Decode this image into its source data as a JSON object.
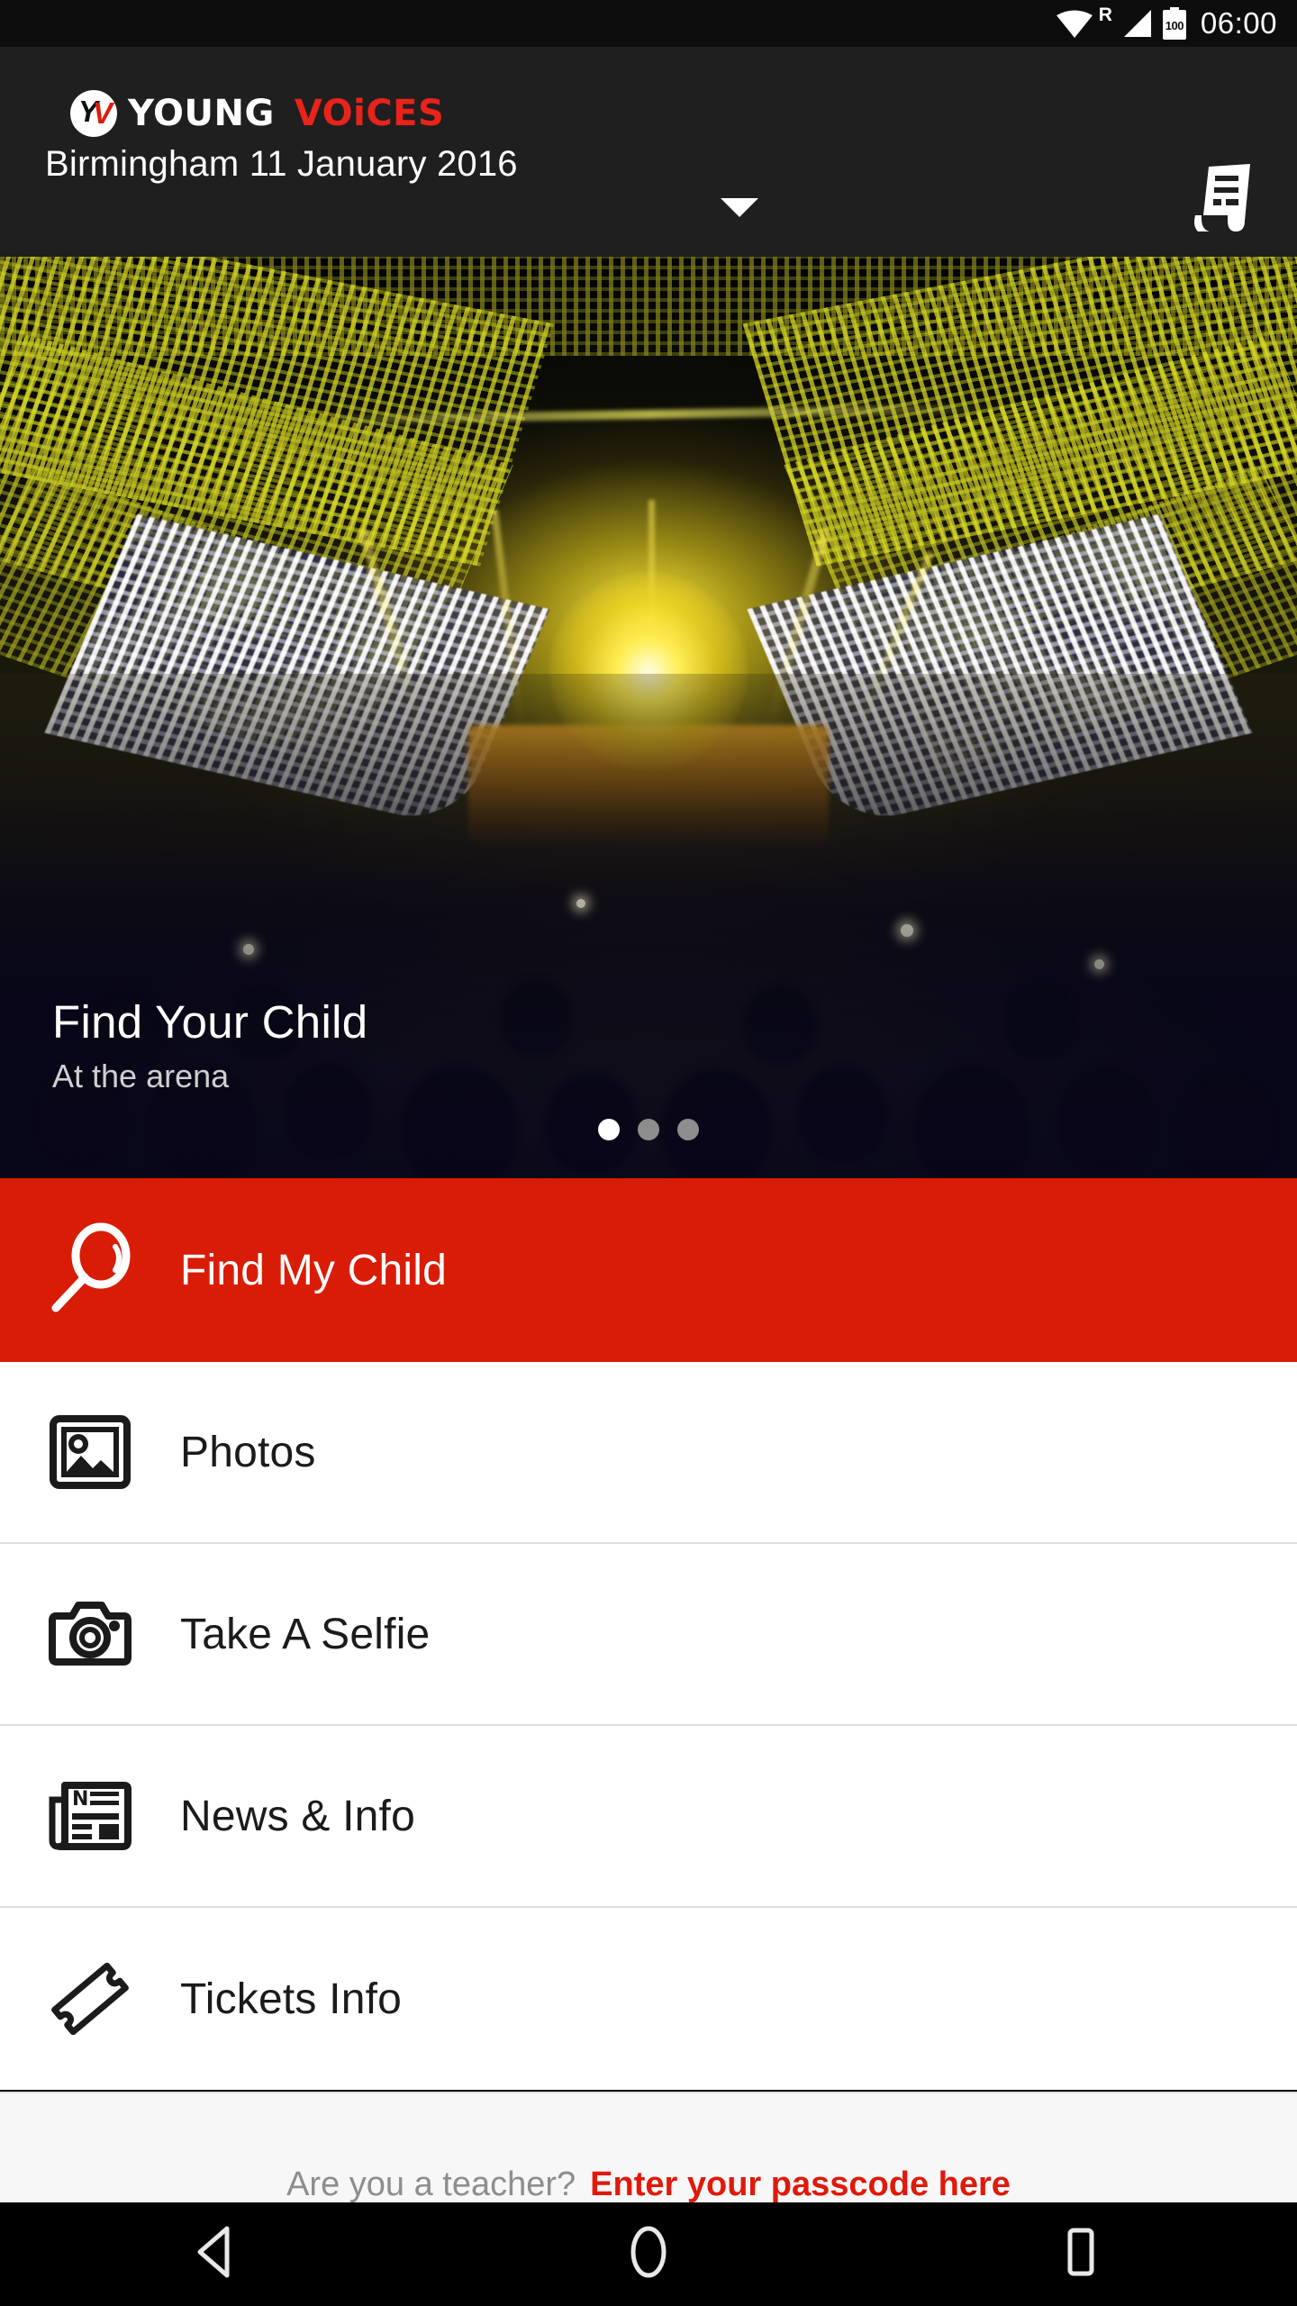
{
  "status_bar": {
    "wifi_icon": "wifi-icon",
    "roaming_label": "R",
    "signal_icon": "cellular-signal-icon",
    "battery_level": "100",
    "time": "06:00"
  },
  "app_bar": {
    "logo_badge": "yv-monogram-logo",
    "logo_y": "Y",
    "logo_v": "V",
    "brand_first": "YOUNG",
    "brand_second": "VOiCES",
    "subtitle": "Birmingham 11 January 2016",
    "dropdown_icon": "chevron-down-icon",
    "action_icon": "receipt-icon",
    "background": "#1f1f1f",
    "brand_red": "#e8231a"
  },
  "tabs": {
    "active_index": 0,
    "indicator_color": "#d8190a",
    "items": [
      {
        "icon": "music-note-icon",
        "name": "tab-music",
        "active": true
      },
      {
        "icon": "child-person-icon",
        "name": "tab-child",
        "active": false
      },
      {
        "icon": "arena-building-icon",
        "name": "tab-arena",
        "active": false
      }
    ]
  },
  "hero": {
    "title": "Find Your Child",
    "subtitle": "At the arena",
    "image_description": "concert-arena-crowd-photo",
    "carousel": {
      "total": 3,
      "active": 1
    }
  },
  "primary_action": {
    "label": "Find My Child",
    "icon": "magnifier-icon",
    "background": "#d91c06",
    "text_color": "#ffffff"
  },
  "menu": {
    "items": [
      {
        "label": "Photos",
        "icon": "photo-frame-icon"
      },
      {
        "label": "Take A Selfie",
        "icon": "camera-icon"
      },
      {
        "label": "News & Info",
        "icon": "newspaper-icon"
      },
      {
        "label": "Tickets Info",
        "icon": "ticket-icon"
      }
    ]
  },
  "footer": {
    "question": "Are you a teacher?",
    "link": "Enter your passcode here",
    "link_color": "#e0190b"
  },
  "navigation_bar": {
    "back": "back-triangle-icon",
    "home": "home-circle-icon",
    "recents": "recents-square-icon"
  }
}
